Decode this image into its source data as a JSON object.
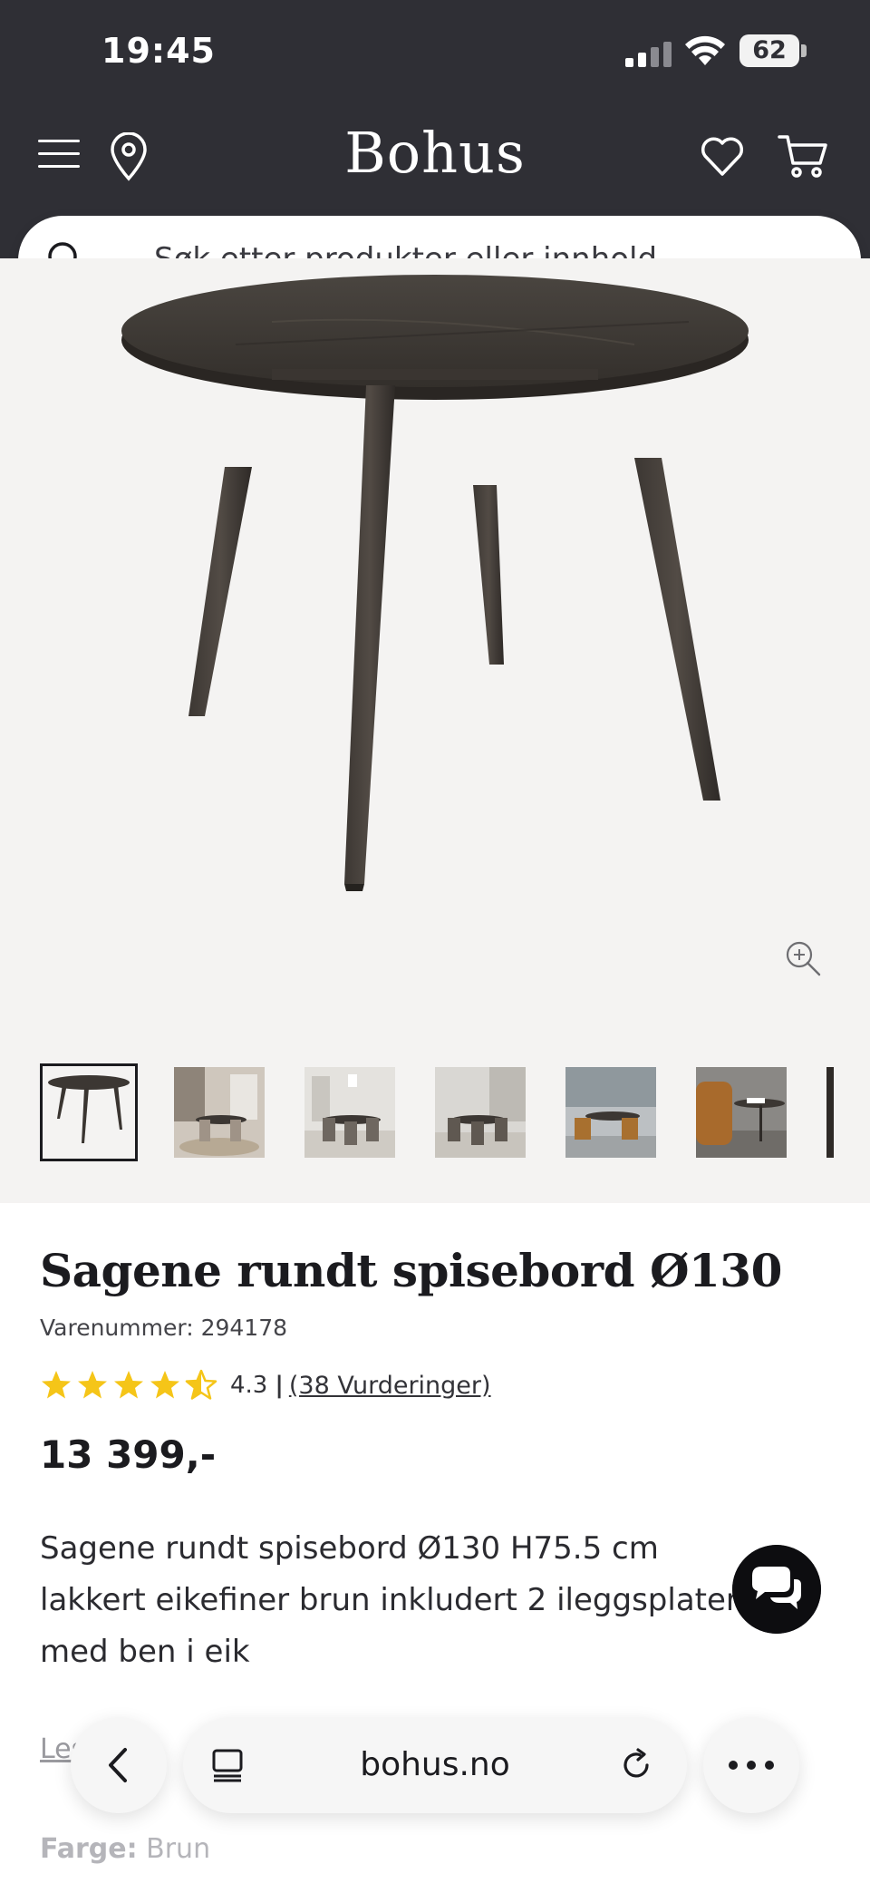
{
  "status_bar": {
    "time": "19:45",
    "battery": "62"
  },
  "header": {
    "brand": "Bohus",
    "search_placeholder": "Søk etter produkter eller innhold...",
    "icons": [
      "menu-icon",
      "location-pin-icon",
      "heart-icon",
      "cart-icon",
      "search-icon"
    ],
    "background": "#2f2f35"
  },
  "gallery": {
    "thumbnail_count": 7,
    "selected_index": 0
  },
  "product": {
    "title": "Sagene rundt spisebord Ø130",
    "sku": "Varenummer: 294178",
    "rating_value": "4.3",
    "rating_separator": "|",
    "rating_link": "(38 Vurderinger)",
    "stars": 4.5,
    "price": "13 399,-",
    "description": "Sagene rundt spisebord Ø130 H75.5 cm lakkert eikefiner brun inkludert 2 ileggsplater med ben i eik",
    "read_more": "Les mer",
    "color_label": "Farge:",
    "color_value": "Brun",
    "star_color": "#f5c518"
  },
  "browser": {
    "url": "bohus.no"
  }
}
